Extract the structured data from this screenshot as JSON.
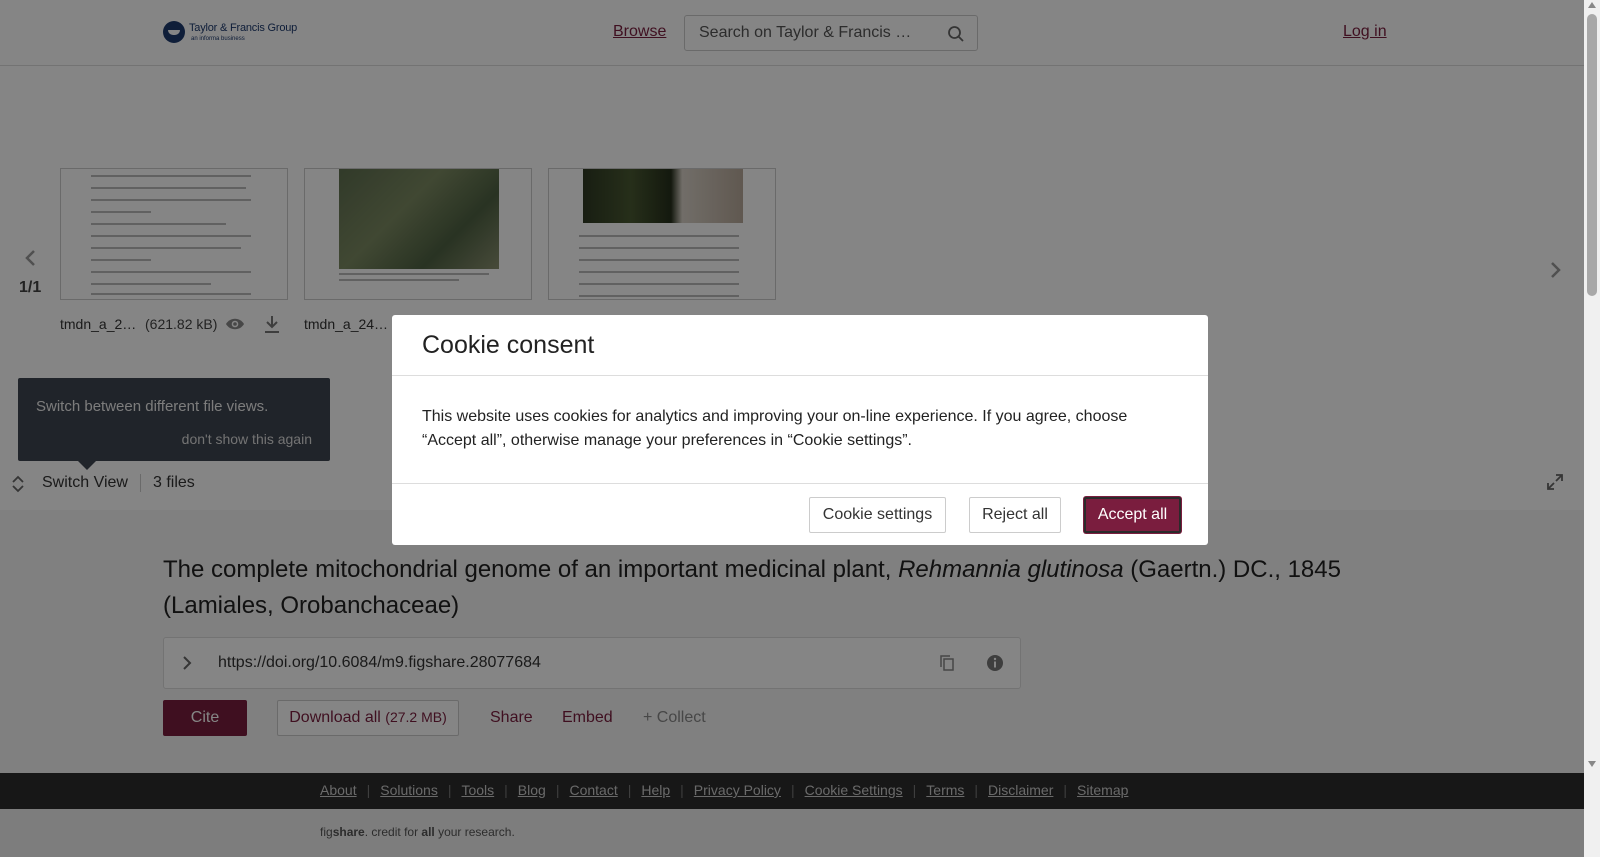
{
  "header": {
    "logo_name": "Taylor & Francis Group",
    "logo_sub": "an informa business",
    "browse": "Browse",
    "search_placeholder": "Search on Taylor & Francis …",
    "login": "Log in"
  },
  "viewer": {
    "pager": "1/1",
    "files": [
      {
        "name": "tmdn_a_2…",
        "size": "(621.82 kB)"
      },
      {
        "name": "tmdn_a_24…"
      }
    ],
    "tip": {
      "text": "Switch between different file views.",
      "dismiss": "don't show this again"
    },
    "switch_view": "Switch View",
    "files_count": "3 files"
  },
  "article": {
    "title_prefix": "The complete mitochondrial genome of an important medicinal plant, ",
    "title_italic": "Rehmannia glutinosa",
    "title_suffix": " (Gaertn.) DC., 1845 (Lamiales, Orobanchaceae)",
    "doi": "https://doi.org/10.6084/m9.figshare.28077684",
    "cite": "Cite",
    "download_label": "Download all ",
    "download_size": "(27.2 MB)",
    "share": "Share",
    "embed": "Embed",
    "collect": "+ Collect"
  },
  "footer": {
    "links": [
      "About",
      "Solutions",
      "Tools",
      "Blog",
      "Contact",
      "Help",
      "Privacy Policy",
      "Cookie Settings",
      "Terms",
      "Disclaimer",
      "Sitemap"
    ],
    "tagline_pre": "fig",
    "tagline_bold": "share",
    "tagline_mid": ". credit for ",
    "tagline_all": "all",
    "tagline_post": " your research."
  },
  "cookie": {
    "title": "Cookie consent",
    "body": "This website uses cookies for analytics and improving your on-line experience. If you agree, choose “Accept all”, otherwise manage your preferences in “Cookie settings”.",
    "settings": "Cookie settings",
    "reject": "Reject all",
    "accept": "Accept all"
  },
  "colors": {
    "brand": "#7a1d3e",
    "logo_blue": "#1d3a6e",
    "overlay": "rgba(0,0,0,0.48)"
  }
}
